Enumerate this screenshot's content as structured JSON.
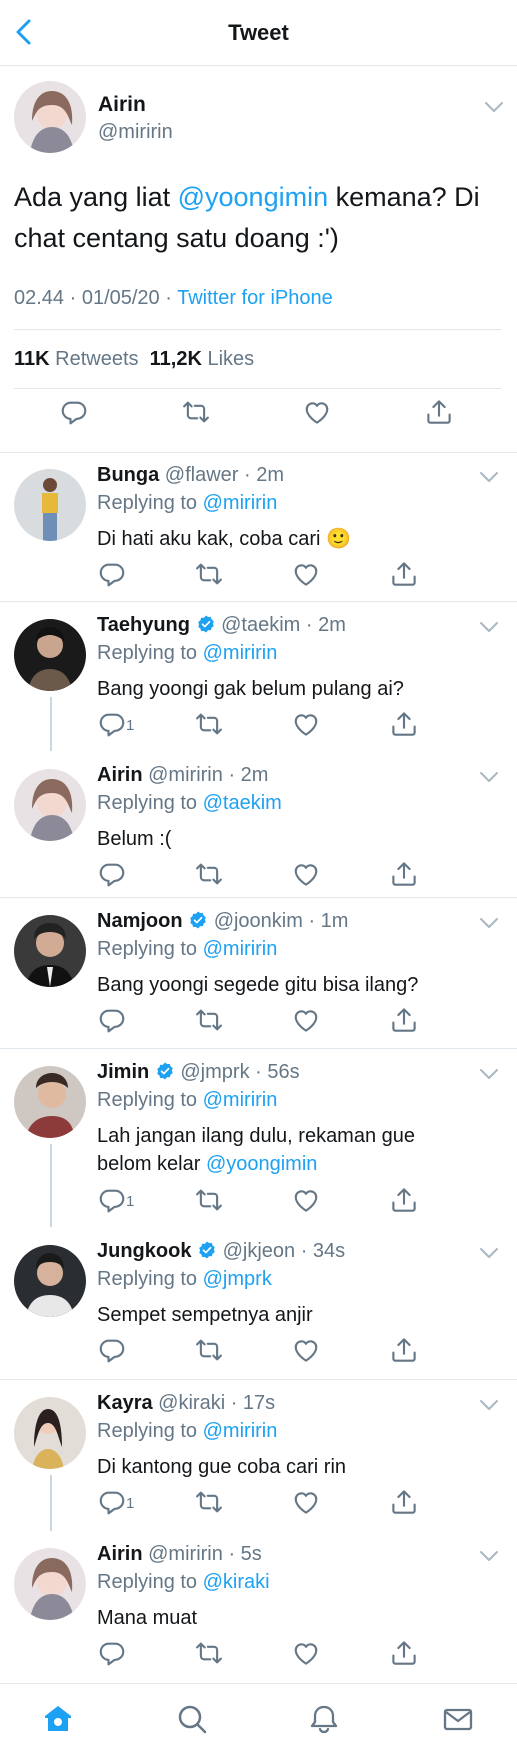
{
  "header": {
    "title": "Tweet",
    "back_icon": "back-arrow-icon"
  },
  "tweet": {
    "name": "Airin",
    "handle": "@miririn",
    "text_before": "Ada yang liat ",
    "mention": "@yoongimin",
    "text_after": " kemana? Di chat centang satu doang :')",
    "time": "02.44 · 01/05/20 · ",
    "source": "Twitter for iPhone",
    "retweets_count": "11K",
    "retweets_label": "Retweets",
    "likes_count": "11,2K",
    "likes_label": "Likes"
  },
  "replies": [
    {
      "name": "Bunga",
      "verified": false,
      "handle": "@flawer",
      "time": "· 2m",
      "replying": "Replying to ",
      "to": "@miririn",
      "text": "Di hati aku kak, coba cari",
      "emoji": "🙂",
      "reply_count": ""
    },
    {
      "name": "Taehyung",
      "verified": true,
      "handle": "@taekim",
      "time": "· 2m",
      "replying": "Replying to ",
      "to": "@miririn",
      "text": "Bang yoongi gak belum pulang ai?",
      "reply_count": "1"
    },
    {
      "name": "Airin",
      "verified": false,
      "handle": "@miririn",
      "time": "· 2m",
      "replying": "Replying to ",
      "to": "@taekim",
      "text": "Belum :(",
      "reply_count": ""
    },
    {
      "name": "Namjoon",
      "verified": true,
      "handle": "@joonkim",
      "time": "· 1m",
      "replying": "Replying to ",
      "to": "@miririn",
      "text": "Bang yoongi segede gitu bisa ilang?",
      "reply_count": ""
    },
    {
      "name": "Jimin",
      "verified": true,
      "handle": "@jmprk",
      "time": "· 56s",
      "replying": "Replying to ",
      "to": "@miririn",
      "text": "Lah jangan ilang dulu, rekaman gue",
      "text2": "belom kelar ",
      "mention": "@yoongimin",
      "reply_count": "1"
    },
    {
      "name": "Jungkook",
      "verified": true,
      "handle": "@jkjeon",
      "time": "· 34s",
      "replying": "Replying to ",
      "to": "@jmprk",
      "text": "Sempet sempetnya anjir",
      "reply_count": ""
    },
    {
      "name": "Kayra",
      "verified": false,
      "handle": "@kiraki",
      "time": "· 17s",
      "replying": "Replying to ",
      "to": "@miririn",
      "text": "Di kantong gue coba cari rin",
      "reply_count": "1"
    },
    {
      "name": "Airin",
      "verified": false,
      "handle": "@miririn",
      "time": "· 5s",
      "replying": "Replying to ",
      "to": "@kiraki",
      "text": "Mana muat",
      "reply_count": ""
    }
  ],
  "tabs": [
    "home-icon",
    "search-icon",
    "notifications-icon",
    "messages-icon"
  ],
  "colors": {
    "accent": "#1da1f2",
    "secondary": "#657786",
    "border": "#e1e8ed"
  }
}
